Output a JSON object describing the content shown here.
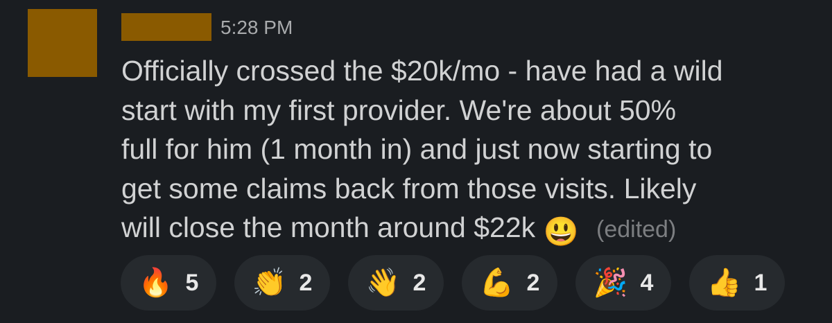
{
  "message": {
    "timestamp": "5:28 PM",
    "lines": [
      "Officially crossed the $20k/mo - have had a wild",
      "start with my first provider. We're about 50%",
      "full for him (1 month in) and just now starting to",
      "get some claims back from those visits. Likely",
      "will close the month around $22k"
    ],
    "inline_emoji": "😃",
    "edited_label": "(edited)"
  },
  "reactions": [
    {
      "emoji": "🔥",
      "name": "fire-icon",
      "count": "5"
    },
    {
      "emoji": "👏",
      "name": "clapping-hands-icon",
      "count": "2"
    },
    {
      "emoji": "👋",
      "name": "waving-hand-icon",
      "count": "2"
    },
    {
      "emoji": "💪",
      "name": "flexed-biceps-icon",
      "count": "2"
    },
    {
      "emoji": "🎉",
      "name": "party-popper-icon",
      "count": "4"
    },
    {
      "emoji": "👍",
      "name": "thumbs-up-icon",
      "count": "1"
    }
  ]
}
